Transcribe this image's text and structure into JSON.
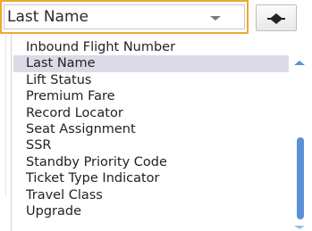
{
  "select": {
    "value": "Last Name"
  },
  "dropdown": {
    "items": [
      {
        "label": "Inbound Flight Number",
        "selected": false
      },
      {
        "label": "Last Name",
        "selected": true
      },
      {
        "label": "Lift Status",
        "selected": false
      },
      {
        "label": "Premium Fare",
        "selected": false
      },
      {
        "label": "Record Locator",
        "selected": false
      },
      {
        "label": "Seat Assignment",
        "selected": false
      },
      {
        "label": "SSR",
        "selected": false
      },
      {
        "label": "Standby Priority Code",
        "selected": false
      },
      {
        "label": "Ticket Type Indicator",
        "selected": false
      },
      {
        "label": "Travel Class",
        "selected": false
      },
      {
        "label": "Upgrade",
        "selected": false
      }
    ]
  },
  "icons": {
    "dropdown_arrow": "chevron-down-icon",
    "sort": "sort-icon",
    "scroll_up": "scroll-up-icon",
    "scroll_down": "scroll-down-icon"
  },
  "colors": {
    "focus_border": "#f0a830",
    "selected_row": "#dadbe6",
    "scrollbar": "#5b8fd6"
  }
}
